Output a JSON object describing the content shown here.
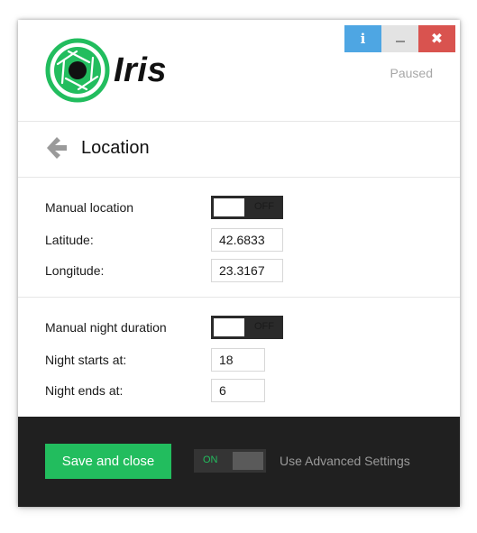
{
  "app": {
    "name": "Iris",
    "status": "Paused"
  },
  "window_controls": {
    "info": "i",
    "minimize": "",
    "close": "✖"
  },
  "page": {
    "title": "Location"
  },
  "location": {
    "manual_label": "Manual location",
    "manual_toggle": "OFF",
    "latitude_label": "Latitude:",
    "latitude_value": "42.6833",
    "longitude_label": "Longitude:",
    "longitude_value": "23.3167"
  },
  "night": {
    "manual_label": "Manual night duration",
    "manual_toggle": "OFF",
    "starts_label": "Night starts at:",
    "starts_value": "18",
    "ends_label": "Night ends at:",
    "ends_value": "6"
  },
  "footer": {
    "save_label": "Save and close",
    "advanced_toggle": "ON",
    "advanced_label": "Use Advanced Settings"
  },
  "colors": {
    "accent_green": "#22bd5e",
    "info_blue": "#4ea6e3",
    "close_red": "#d9534f",
    "footer_bg": "#202020"
  }
}
